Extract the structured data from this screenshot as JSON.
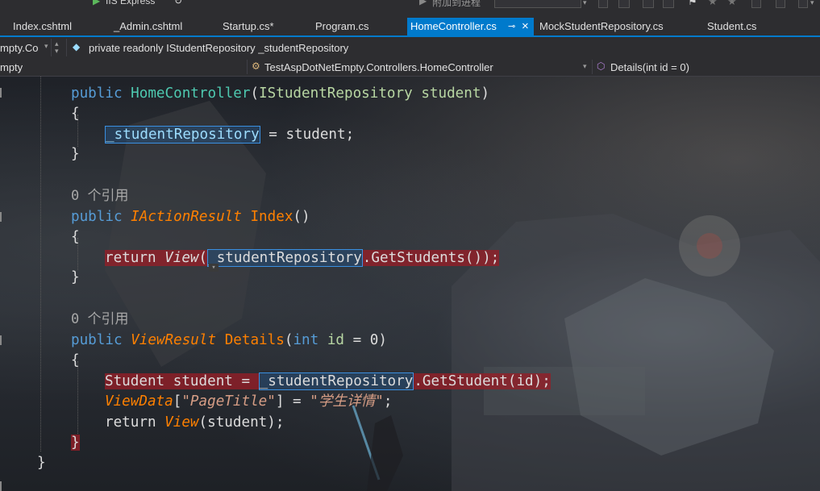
{
  "toolbar": {
    "iis_label": "IIS Express",
    "attach_label": "附加到进程"
  },
  "tabs": [
    {
      "label": "Index.cshtml",
      "active": false
    },
    {
      "label": "_Admin.cshtml",
      "active": false
    },
    {
      "label": "Startup.cs*",
      "active": false
    },
    {
      "label": "Program.cs",
      "active": false
    },
    {
      "label": "HomeController.cs",
      "active": true
    },
    {
      "label": "MockStudentRepository.cs",
      "active": false
    },
    {
      "label": "Student.cs",
      "active": false
    }
  ],
  "nav": {
    "project_dropdown": "mpty.Co",
    "member_display": "private readonly IStudentRepository _studentRepository",
    "project_left": "mpty",
    "class_dropdown": "TestAspDotNetEmpty.Controllers.HomeController",
    "method_dropdown": "Details(int id = 0)"
  },
  "code": {
    "ctor_kw": "public",
    "ctor_name": "HomeController",
    "ctor_param_type": "IStudentRepository",
    "ctor_param_name": "student",
    "brace_open": "{",
    "brace_close": "}",
    "assign_field": "_studentRepository",
    "assign_rest": " = student;",
    "ref_count_1": "0 个引用",
    "index_kw": "public",
    "index_type": "IActionResult",
    "index_name": "Index",
    "index_parens": "()",
    "return_kw": "return",
    "view_call": "View",
    "field_ref": "_studentRepository",
    "get_students": ".GetStudents());",
    "ref_count_2": "0 个引用",
    "details_kw": "public",
    "details_type": "ViewResult",
    "details_name": "Details",
    "details_int": "int",
    "details_param": "id",
    "details_default": " = 0)",
    "student_decl": "Student student = ",
    "get_student": ".GetStudent(id);",
    "viewdata": "ViewData",
    "viewdata_key": "\"PageTitle\"",
    "viewdata_val": "\"学生详情\"",
    "return_view_arg": "(student);"
  }
}
